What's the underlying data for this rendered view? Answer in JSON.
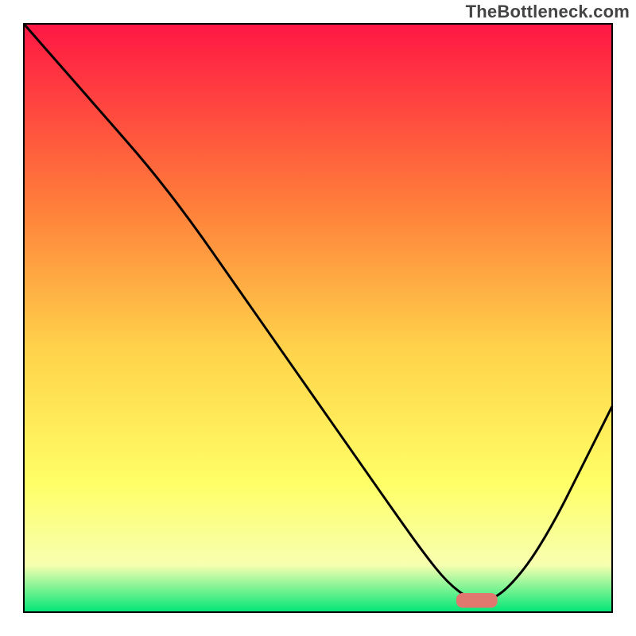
{
  "watermark": "TheBottleneck.com",
  "chart_data": {
    "type": "line",
    "title": "",
    "xlabel": "",
    "ylabel": "",
    "xlim": [
      0,
      100
    ],
    "ylim": [
      0,
      100
    ],
    "x": [
      0,
      7,
      14,
      21,
      28,
      35,
      42,
      49,
      56,
      63,
      68,
      72,
      76,
      80,
      85,
      90,
      95,
      100
    ],
    "values": [
      100,
      92,
      84,
      76,
      67,
      57,
      47,
      37,
      27,
      17,
      10,
      5,
      2,
      2,
      7,
      15,
      25,
      35
    ],
    "marker": {
      "x": 77,
      "y": 2,
      "width": 7,
      "height": 2.5
    },
    "colors": {
      "gradient_top": "#ff1744",
      "gradient_mid_upper": "#ff7b3a",
      "gradient_mid": "#ffd24a",
      "gradient_mid_lower": "#ffff66",
      "gradient_lower": "#f7ffb0",
      "gradient_bottom": "#00e676",
      "line": "#000000",
      "marker": "#e0786f",
      "frame": "#000000"
    }
  }
}
